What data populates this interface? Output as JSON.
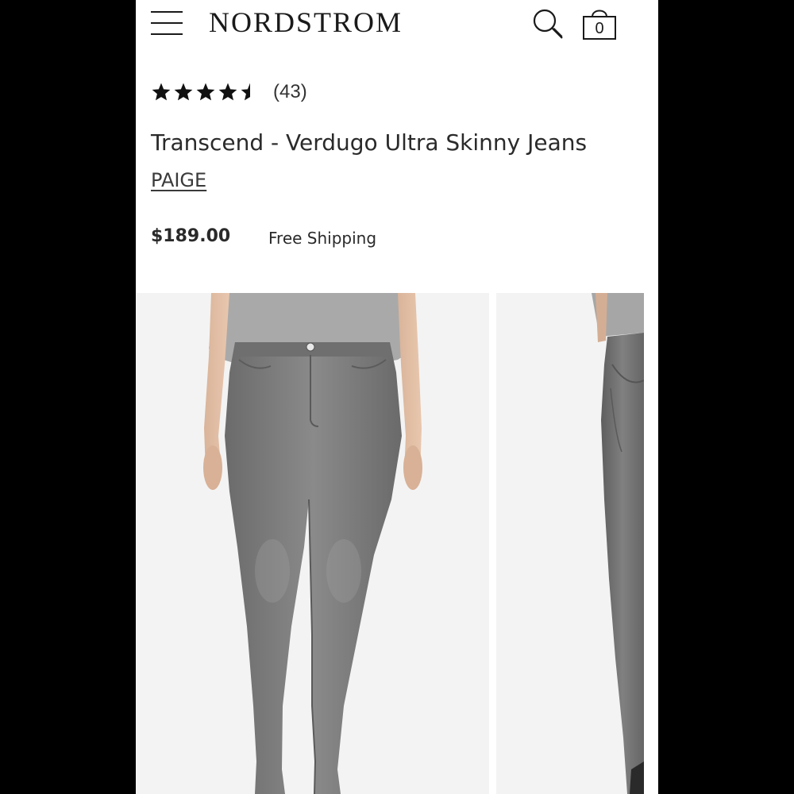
{
  "header": {
    "logo": "NORDSTROM",
    "menu_icon": "hamburger-menu-icon",
    "search_icon": "search-icon",
    "bag_icon": "shopping-bag-icon",
    "bag_count": "0"
  },
  "product": {
    "rating": 4.5,
    "rating_max": 5,
    "review_count": "(43)",
    "title": "Transcend - Verdugo Ultra Skinny Jeans",
    "brand": "PAIGE",
    "price": "$189.00",
    "shipping": "Free Shipping"
  },
  "gallery": {
    "images": [
      "front-view-photo",
      "back-view-photo"
    ]
  },
  "colors": {
    "background": "#000000",
    "page": "#ffffff",
    "text": "#2a2a2a",
    "denim": "#7a7a7a",
    "photo_bg": "#f3f3f3"
  }
}
